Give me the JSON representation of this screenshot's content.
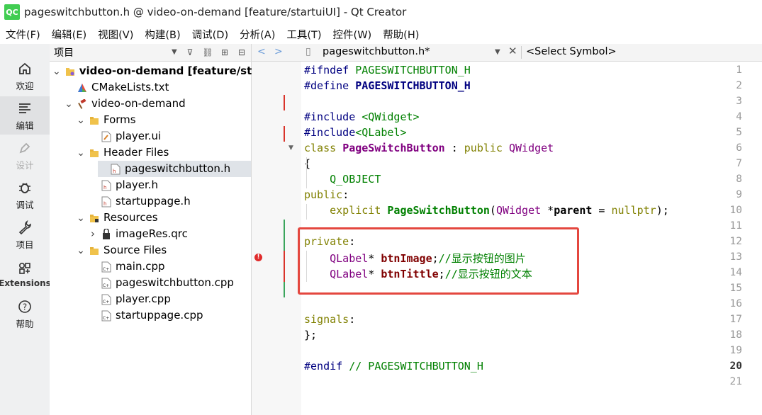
{
  "window": {
    "title": "pageswitchbutton.h @ video-on-demand [feature/startuiUI] - Qt Creator",
    "logo": "QC"
  },
  "menu": [
    "文件(F)",
    "编辑(E)",
    "视图(V)",
    "构建(B)",
    "调试(D)",
    "分析(A)",
    "工具(T)",
    "控件(W)",
    "帮助(H)"
  ],
  "modes": [
    {
      "label": "欢迎",
      "icon": "home-icon"
    },
    {
      "label": "编辑",
      "icon": "edit-lines-icon"
    },
    {
      "label": "设计",
      "icon": "pen-icon"
    },
    {
      "label": "调试",
      "icon": "bug-icon"
    },
    {
      "label": "项目",
      "icon": "wrench-icon"
    },
    {
      "label": "Extensions",
      "icon": "extensions-icon"
    },
    {
      "label": "帮助",
      "icon": "help-icon"
    }
  ],
  "navigator": {
    "label": "项目",
    "tree": [
      {
        "label": "video-on-demand [feature/start",
        "depth": 0,
        "expanded": true,
        "icon": "project-icon",
        "bold": true
      },
      {
        "label": "CMakeLists.txt",
        "depth": 1,
        "icon": "cmake-icon"
      },
      {
        "label": "video-on-demand",
        "depth": 1,
        "expanded": true,
        "icon": "hammer-icon"
      },
      {
        "label": "Forms",
        "depth": 2,
        "expanded": true,
        "icon": "folder-icon"
      },
      {
        "label": "player.ui",
        "depth": 3,
        "icon": "ui-file-icon"
      },
      {
        "label": "Header Files",
        "depth": 2,
        "expanded": true,
        "icon": "folder-icon"
      },
      {
        "label": "pageswitchbutton.h",
        "depth": 3,
        "icon": "header-file-icon",
        "selected": true
      },
      {
        "label": "player.h",
        "depth": 3,
        "icon": "header-file-icon"
      },
      {
        "label": "startuppage.h",
        "depth": 3,
        "icon": "header-file-icon"
      },
      {
        "label": "Resources",
        "depth": 2,
        "expanded": true,
        "icon": "folder-lock-icon"
      },
      {
        "label": "imageRes.qrc",
        "depth": 3,
        "collapsed": true,
        "icon": "qrc-icon"
      },
      {
        "label": "Source Files",
        "depth": 2,
        "expanded": true,
        "icon": "folder-icon"
      },
      {
        "label": "main.cpp",
        "depth": 3,
        "icon": "cpp-file-icon"
      },
      {
        "label": "pageswitchbutton.cpp",
        "depth": 3,
        "icon": "cpp-file-icon"
      },
      {
        "label": "player.cpp",
        "depth": 3,
        "icon": "cpp-file-icon"
      },
      {
        "label": "startuppage.cpp",
        "depth": 3,
        "icon": "cpp-file-icon"
      }
    ]
  },
  "editor": {
    "file_name": "pageswitchbutton.h*",
    "symbol": "<Select Symbol>",
    "current_line": 20,
    "lines": [
      {
        "n": 1,
        "tokens": [
          [
            "pp",
            "#ifndef "
          ],
          [
            "str",
            "PAGESWITCHBUTTON_H"
          ]
        ]
      },
      {
        "n": 2,
        "tokens": [
          [
            "pp",
            "#define "
          ],
          [
            "pp bold",
            "PAGESWITCHBUTTON_H"
          ]
        ]
      },
      {
        "n": 3,
        "tokens": []
      },
      {
        "n": 4,
        "tokens": [
          [
            "pp",
            "#include "
          ],
          [
            "str",
            "<QWidget>"
          ]
        ]
      },
      {
        "n": 5,
        "tokens": [
          [
            "pp",
            "#include"
          ],
          [
            "str",
            "<QLabel>"
          ]
        ]
      },
      {
        "n": 6,
        "tokens": [
          [
            "kw",
            "class "
          ],
          [
            "ty bold",
            "PageSwitchButton"
          ],
          [
            "",
            " : "
          ],
          [
            "kw",
            "public "
          ],
          [
            "ty",
            "QWidget"
          ]
        ]
      },
      {
        "n": 7,
        "tokens": [
          [
            "",
            "{"
          ]
        ]
      },
      {
        "n": 8,
        "tokens": [
          [
            "",
            "    "
          ],
          [
            "str",
            "Q_OBJECT"
          ]
        ]
      },
      {
        "n": 9,
        "tokens": [
          [
            "kw",
            "public"
          ],
          [
            "",
            ":"
          ]
        ]
      },
      {
        "n": 10,
        "tokens": [
          [
            "",
            "    "
          ],
          [
            "kw",
            "explicit "
          ],
          [
            "str bold",
            "PageSwitchButton"
          ],
          [
            "",
            "("
          ],
          [
            "ty",
            "QWidget"
          ],
          [
            "",
            " *"
          ],
          [
            "bold",
            "parent"
          ],
          [
            "",
            " = "
          ],
          [
            "kw",
            "nullptr"
          ],
          [
            "",
            ");"
          ]
        ]
      },
      {
        "n": 11,
        "tokens": []
      },
      {
        "n": 12,
        "tokens": [
          [
            "kw",
            "private"
          ],
          [
            "",
            ":"
          ]
        ]
      },
      {
        "n": 13,
        "tokens": [
          [
            "",
            "    "
          ],
          [
            "ty",
            "QLabel"
          ],
          [
            "",
            "* "
          ],
          [
            "mem bold",
            "btnImage"
          ],
          [
            "",
            ";"
          ],
          [
            "cm",
            "//显示按钮的图片"
          ]
        ]
      },
      {
        "n": 14,
        "tokens": [
          [
            "",
            "    "
          ],
          [
            "ty",
            "QLabel"
          ],
          [
            "",
            "* "
          ],
          [
            "mem bold",
            "btnTittle"
          ],
          [
            "",
            ";"
          ],
          [
            "cm",
            "//显示按钮的文本"
          ]
        ]
      },
      {
        "n": 15,
        "tokens": []
      },
      {
        "n": 16,
        "tokens": []
      },
      {
        "n": 17,
        "tokens": [
          [
            "kw",
            "signals"
          ],
          [
            "",
            ":"
          ]
        ]
      },
      {
        "n": 18,
        "tokens": [
          [
            "",
            "};"
          ]
        ]
      },
      {
        "n": 19,
        "tokens": []
      },
      {
        "n": 20,
        "tokens": [
          [
            "pp",
            "#endif "
          ],
          [
            "cm",
            "// PAGESWITCHBUTTON_H"
          ]
        ]
      },
      {
        "n": 21,
        "tokens": []
      }
    ]
  },
  "colors": {
    "accent_red": "#e4473f",
    "selection": "#dfe3e8",
    "qt_green": "#41cd52"
  }
}
